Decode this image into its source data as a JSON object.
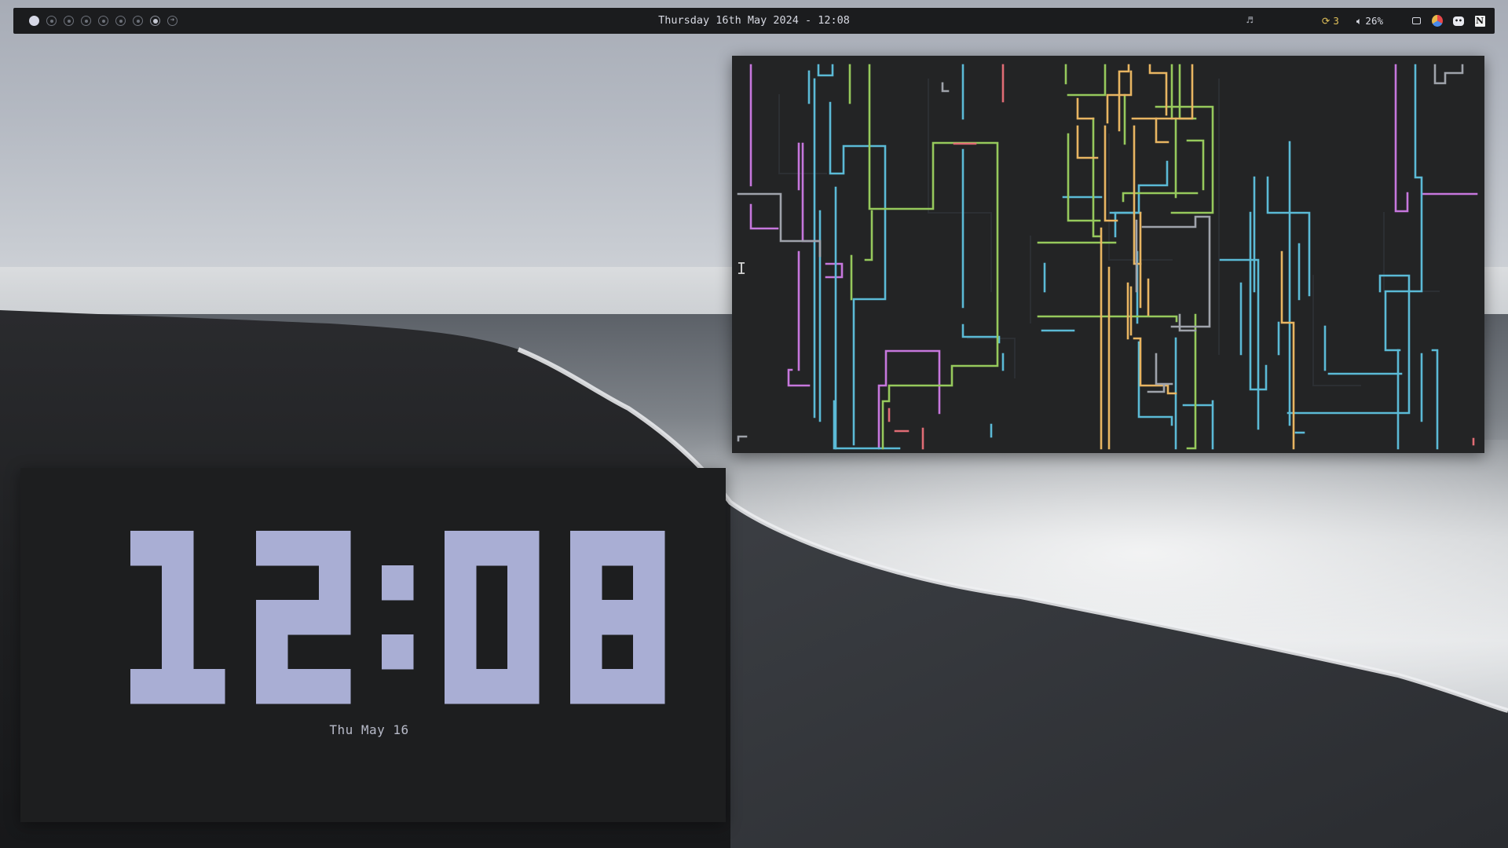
{
  "topbar": {
    "datetime": "Thursday 16th May 2024 - 12:08",
    "workspaces": [
      {
        "state": "active"
      },
      {
        "state": "empty"
      },
      {
        "state": "empty"
      },
      {
        "state": "empty"
      },
      {
        "state": "empty"
      },
      {
        "state": "empty"
      },
      {
        "state": "empty"
      },
      {
        "state": "occupied"
      },
      {
        "state": "next-arrow"
      }
    ],
    "tray": {
      "music_icon": "music-note-icon",
      "updates_count": "3",
      "updates_icon": "refresh-icon",
      "volume_icon": "speaker-icon",
      "volume_value": "26%",
      "apps": [
        "screen-icon",
        "browser-icon",
        "discord-icon",
        "notion-icon"
      ]
    },
    "colors": {
      "bar_bg": "#1b1c1e",
      "text": "#d7d9e2",
      "updates": "#e1c15a"
    }
  },
  "pipes_window": {
    "app": "terminal-pipes",
    "pipe_colors": [
      "#c677dd",
      "#5bbad6",
      "#96c95c",
      "#e8b562",
      "#e06c75",
      "#9fa3ab",
      "#61afef"
    ]
  },
  "clock_window": {
    "time": "12:08",
    "date": "Thu May 16",
    "digit_color": "#a9aed4"
  }
}
